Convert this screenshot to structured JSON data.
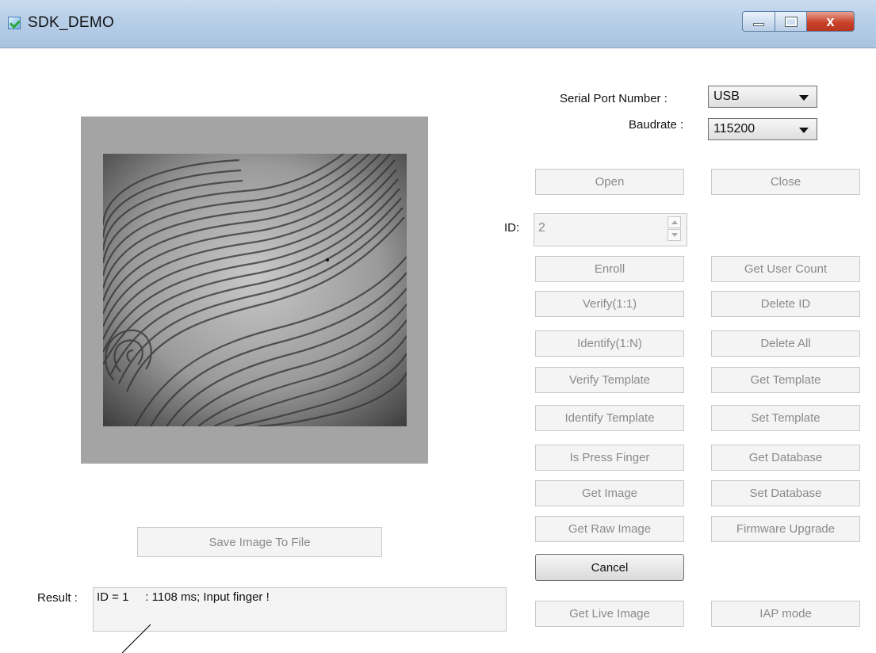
{
  "window": {
    "title": "SDK_DEMO",
    "close_glyph": "x"
  },
  "connection": {
    "port_label": "Serial Port Number :",
    "port_value": "USB",
    "baud_label": "Baudrate :",
    "baud_value": "115200"
  },
  "buttons": {
    "open": "Open",
    "close": "Close",
    "enroll": "Enroll",
    "get_user_count": "Get User Count",
    "verify": "Verify(1:1)",
    "delete_id": "Delete ID",
    "identify": "Identify(1:N)",
    "delete_all": "Delete All",
    "verify_template": "Verify Template",
    "get_template": "Get Template",
    "identify_template": "Identify Template",
    "set_template": "Set Template",
    "is_press_finger": "Is Press Finger",
    "get_database": "Get Database",
    "get_image": "Get Image",
    "set_database": "Set Database",
    "get_raw_image": "Get Raw Image",
    "firmware_upgrade": "Firmware Upgrade",
    "cancel": "Cancel",
    "get_live_image": "Get Live Image",
    "iap_mode": "IAP mode",
    "save_image": "Save Image To File"
  },
  "id_field": {
    "label": "ID:",
    "value": "2"
  },
  "result": {
    "label": "Result :",
    "text": "ID = 1     : 1108 ms; Input finger !"
  },
  "icons": [
    "app-icon",
    "minimize-icon",
    "maximize-icon",
    "close-icon",
    "dropdown-arrow-icon",
    "spin-up-icon",
    "spin-down-icon"
  ]
}
